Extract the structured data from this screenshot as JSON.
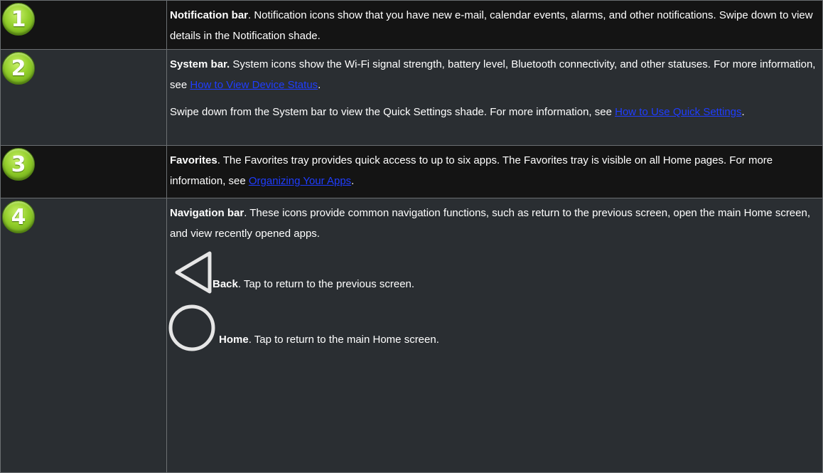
{
  "rows": [
    {
      "number": "1",
      "paragraphs": [
        {
          "bold": "Notification bar",
          "text": ". Notification icons show that you have new e-mail, calendar events, alarms, and other notifications. Swipe down to view details in the Notification shade."
        }
      ]
    },
    {
      "number": "2",
      "paragraphs": [
        {
          "bold": "System bar.",
          "text": " System icons show the Wi-Fi signal strength, battery level, Bluetooth connectivity, and other statuses. For more information, see ",
          "link": "How to View Device Status",
          "after": "."
        },
        {
          "text": "Swipe down from the System bar to view the Quick Settings shade. For more information, see ",
          "link": "How to Use Quick Settings",
          "after": "."
        }
      ]
    },
    {
      "number": "3",
      "paragraphs": [
        {
          "bold": "Favorites",
          "text": ". The Favorites tray provides quick access to up to six apps. The Favorites tray is visible on all Home pages. For more information, see ",
          "link": "Organizing Your Apps",
          "after": "."
        }
      ]
    },
    {
      "number": "4",
      "paragraphs": [
        {
          "bold": "Navigation bar",
          "text": ". These icons provide common navigation functions, such as return to the previous screen, open the main Home screen, and view recently opened apps."
        }
      ],
      "items": [
        {
          "icon": "back-triangle-icon",
          "bold": "Back",
          "text": ". Tap to return to the previous screen."
        },
        {
          "icon": "home-circle-icon",
          "bold": "Home",
          "text": ". Tap to return to the main Home screen."
        }
      ]
    }
  ]
}
